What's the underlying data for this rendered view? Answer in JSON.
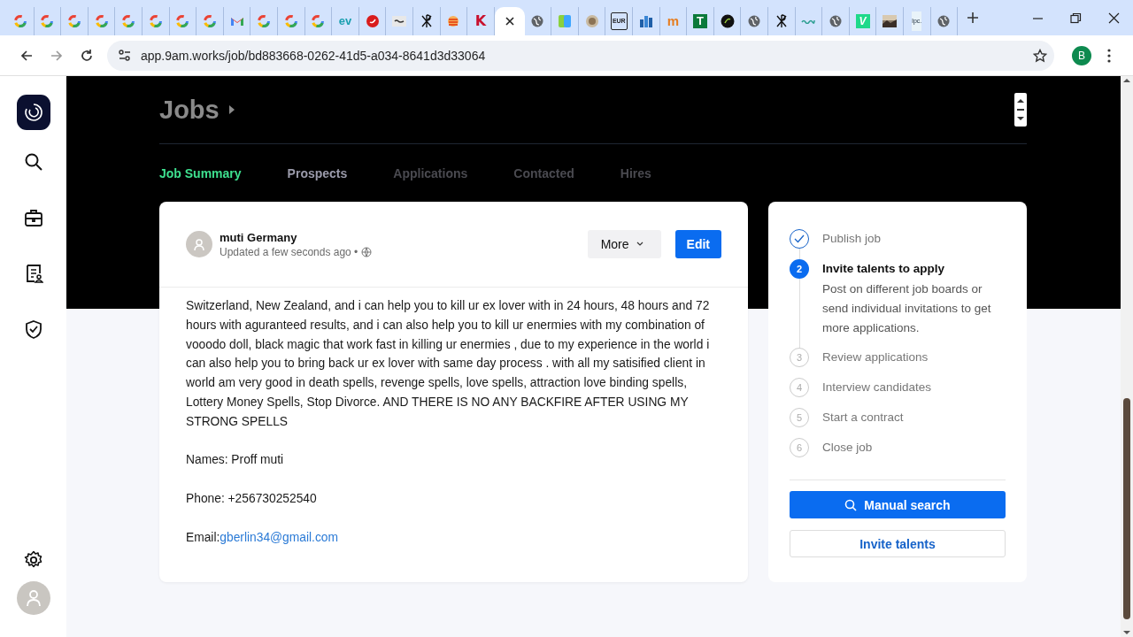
{
  "browser": {
    "tabs": [
      {
        "kind": "google",
        "selected": false
      },
      {
        "kind": "google",
        "selected": false
      },
      {
        "kind": "google",
        "selected": false
      },
      {
        "kind": "google",
        "selected": false
      },
      {
        "kind": "google",
        "selected": false
      },
      {
        "kind": "google",
        "selected": false
      },
      {
        "kind": "google",
        "selected": false
      },
      {
        "kind": "google",
        "selected": false
      },
      {
        "kind": "mail",
        "selected": false
      },
      {
        "kind": "google",
        "selected": false
      },
      {
        "kind": "google",
        "selected": false
      },
      {
        "kind": "google",
        "selected": false
      },
      {
        "kind": "wordmark",
        "text": "ev",
        "selected": false
      },
      {
        "kind": "ball",
        "selected": false
      },
      {
        "kind": "dash",
        "selected": false
      },
      {
        "kind": "chi",
        "selected": false
      },
      {
        "kind": "stack",
        "selected": false
      },
      {
        "kind": "letter",
        "text": "K",
        "selected": false
      },
      {
        "selected": true
      },
      {
        "kind": "globe",
        "selected": false
      },
      {
        "kind": "book",
        "selected": false
      },
      {
        "kind": "seal",
        "selected": false
      },
      {
        "kind": "badge",
        "text": "EUR",
        "selected": false
      },
      {
        "kind": "buildings",
        "selected": false
      },
      {
        "kind": "hat",
        "text": "m",
        "selected": false
      },
      {
        "kind": "tile",
        "text": "T",
        "selected": false
      },
      {
        "kind": "darkball",
        "selected": false
      },
      {
        "kind": "globe",
        "selected": false
      },
      {
        "kind": "chi",
        "selected": false
      },
      {
        "kind": "wave",
        "selected": false
      },
      {
        "kind": "globe",
        "selected": false
      },
      {
        "kind": "tile2",
        "text": "V",
        "selected": false
      },
      {
        "kind": "photo",
        "selected": false
      },
      {
        "kind": "small",
        "text": "lpc.",
        "selected": false
      },
      {
        "kind": "globe",
        "selected": false
      }
    ],
    "url": "app.9am.works/job/bd883668-0262-41d5-a034-8641d3d33064",
    "profile_initial": "B"
  },
  "page": {
    "title": "Jobs",
    "tabs": [
      {
        "label": "Job Summary",
        "selected": true,
        "disabled": false
      },
      {
        "label": "Prospects",
        "selected": false,
        "disabled": false
      },
      {
        "label": "Applications",
        "selected": false,
        "disabled": true
      },
      {
        "label": "Contacted",
        "selected": false,
        "disabled": true
      },
      {
        "label": "Hires",
        "selected": false,
        "disabled": true
      }
    ]
  },
  "post": {
    "author": "muti Germany",
    "updated": "Updated a few seconds ago •",
    "more_button": "More",
    "edit_button": "Edit",
    "paragraphs": [
      "Switzerland, New Zealand, and i can help you to kill ur ex lover with in 24 hours, 48 hours and 72 hours with aguranteed results, and i can also help you to kill ur enermies with my combination of vooodo doll, black magic that work fast in killing ur enermies , due to my experience in the world i can also help you to bring back ur ex lover with same day process . with all my satisified client in world am very good in death spells, revenge spells, love spells, attraction love binding spells, Lottery Money Spells, Stop Divorce. AND THERE IS NO ANY BACKFIRE AFTER USING MY STRONG SPELLS",
      "Names: Proff muti",
      "Phone: +256730252540"
    ],
    "email_label": "Email:",
    "email": "gberlin34@gmail.com"
  },
  "steps": [
    {
      "label": "Publish job",
      "done": true,
      "current": false
    },
    {
      "number": "2",
      "label": "Invite talents to apply",
      "done": false,
      "current": true,
      "description": "Post on different job boards or send individual invitations to get more applications."
    },
    {
      "number": "3",
      "label": "Review applications",
      "done": false,
      "current": false
    },
    {
      "number": "4",
      "label": "Interview candidates",
      "done": false,
      "current": false
    },
    {
      "number": "5",
      "label": "Start a contract",
      "done": false,
      "current": false
    },
    {
      "number": "6",
      "label": "Close job",
      "done": false,
      "current": false
    }
  ],
  "actions": {
    "primary": "Manual search",
    "secondary": "Invite talents"
  }
}
